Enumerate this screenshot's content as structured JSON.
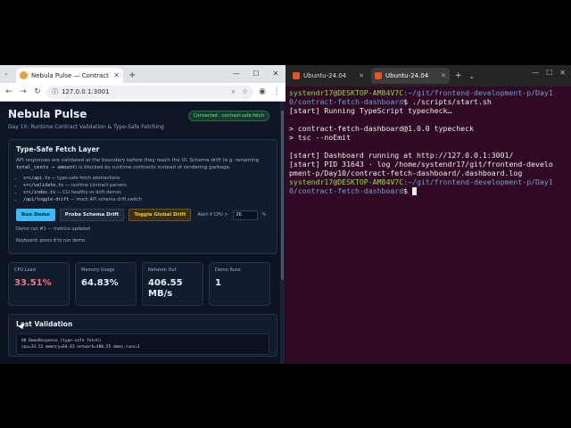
{
  "browser": {
    "tab_title": "Nebula Pulse — Contract Fetch",
    "address": "127.0.0.1:3001"
  },
  "page": {
    "title": "Nebula Pulse",
    "subtitle": "Day 10: Runtime Contract Validation & Type-Safe Fetching",
    "badge": "Connected · contract-safe fetch",
    "main_card": {
      "heading": "Type-Safe Fetch Layer",
      "para_1": "API responses are validated at the boundary before they reach the UI. Schema drift (e.g. renaming",
      "para_code": "total_cents → amount",
      "para_2": ") is blocked by runtime contracts instead of rendering garbage.",
      "bullets": [
        {
          "code": "src/api.ts",
          "text": " — type-safe fetch abstractions"
        },
        {
          "code": "src/validate.ts",
          "text": " — runtime contract parsers"
        },
        {
          "code": "src/index.ts",
          "text": " — CLI healthy vs drift demos"
        },
        {
          "code": "/api/toggle-drift",
          "text": " — mock API schema drift switch"
        }
      ],
      "run_demo": "Run Demo",
      "probe_drift": "Probe Schema Drift",
      "toggle_drift": "Toggle Global Drift",
      "alert_label": "Alert if CPU >",
      "alert_value": "26",
      "alert_unit": "%",
      "demo_status": "Demo run #1 — metrics updated",
      "kbd_prefix": "Keyboard: press ",
      "kbd_key": "d",
      "kbd_suffix": " to run demo."
    },
    "metrics": [
      {
        "label": "CPU Load",
        "value": "33.51%"
      },
      {
        "label": "Memory Usage",
        "value": "64.83%"
      },
      {
        "label": "Network Out",
        "value": "406.55 MB/s"
      },
      {
        "label": "Demo Runs",
        "value": "1"
      }
    ],
    "last_validation": {
      "heading": "Last Validation",
      "line_1": "OK DemoResponse (type-safe fetch)",
      "line_2": "cpu=33.51 memory=64.83 network=406.55 demo_runs=1"
    }
  },
  "terminal": {
    "tabs": [
      "Ubuntu-24.04",
      "Ubuntu-24.04"
    ],
    "new_tab": "+",
    "dropdown": "⌄",
    "controls": [
      "—",
      "☐",
      "✕"
    ],
    "prompt_user": "systendr17@DESKTOP-AM84V7C",
    "prompt_path_1": ":~/git/frontend-development-p/Day1",
    "prompt_path_1b": "0/contract-fetch-dashboard",
    "command_1": "$ ./scripts/start.sh",
    "lines_a": [
      "[start] Running TypeScript typecheck…",
      "",
      "> contract-fetch-dashboard@1.0.0 typecheck",
      "> tsc --noEmit",
      "",
      "[start] Dashboard running at http://127.0.0.1:3001/",
      "[start] PID 31643 · log /home/systendr17/git/frontend-develo",
      "pment-p/Day10/contract-fetch-dashboard/.dashboard.log"
    ],
    "prompt_path_2": ":~/git/frontend-development-p/Day1",
    "prompt_path_2b": "0/contract-fetch-dashboard",
    "command_2": "$ "
  },
  "colors": {
    "terminal_bg": "#300a24",
    "prompt_user": "#8ae234",
    "prompt_path": "#729fcf",
    "page_bg": "#0b1220",
    "accent": "#38bdf8",
    "cpu_hot": "#fb7185"
  }
}
